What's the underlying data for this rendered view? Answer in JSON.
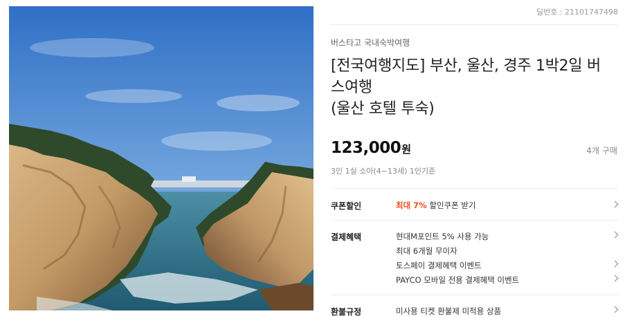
{
  "deal": {
    "number_label": "딜번호 : 21101747498"
  },
  "product": {
    "seller": "버스타고 국내숙박여행",
    "title_line1": "[전국여행지도] 부산, 울산, 경주 1박2일 버",
    "title_line2": "스여행",
    "title_line3": "(울산 호텔 투숙)",
    "price": "123,000",
    "price_unit": "원",
    "buy_count": "4개 구매",
    "price_note": "3인 1실 소아(4~13세) 1인기준"
  },
  "coupon": {
    "label": "쿠폰할인",
    "prefix": "최대 7%",
    "text": " 할인쿠폰 받기"
  },
  "payment": {
    "label": "결제혜택",
    "items": [
      "현대M포인트 5% 사용 가능",
      "최대 6개월 무이자",
      "토스페이 결제혜택 이벤트",
      "PAYCO 모바일 전용 결제혜택 이벤트"
    ]
  },
  "refund": {
    "label": "환불규정",
    "text": "미사용 티켓 환불제 미적용 상품"
  },
  "colors": {
    "accent": "#f04e1b",
    "divider": "#ececec",
    "sky": "#3f7fd0",
    "sea": "#2f6f86",
    "rock": "#c9a577"
  },
  "icons": {
    "row_arrow": "chevron-right-icon"
  }
}
